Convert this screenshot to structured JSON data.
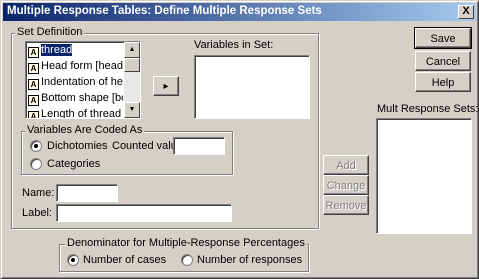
{
  "window": {
    "title": "Multiple Response Tables: Define Multiple Response Sets",
    "close_glyph": "X"
  },
  "set_definition": {
    "label": "Set Definition",
    "variables": [
      {
        "icon": "A",
        "name": "thread",
        "selected": true
      },
      {
        "icon": "A",
        "name": "Head form [head]"
      },
      {
        "icon": "A",
        "name": "Indentation of head"
      },
      {
        "icon": "A",
        "name": "Bottom shape [botto"
      },
      {
        "icon": "A",
        "name": "Length of thread [len"
      }
    ],
    "move_button": "▸",
    "variables_in_set_label": "Variables in Set:",
    "coded_as": {
      "label": "Variables Are Coded As",
      "dichotomies_label": "Dichotomies",
      "counted_value_label": "Counted value:",
      "counted_value": "",
      "categories_label": "Categories",
      "selected": "dichotomies"
    },
    "name_label": "Name:",
    "name_value": "",
    "label_label": "Label:",
    "label_value": ""
  },
  "set_buttons": {
    "add": "Add",
    "change": "Change",
    "remove": "Remove"
  },
  "dialog_buttons": {
    "save": "Save",
    "cancel": "Cancel",
    "help": "Help"
  },
  "mult_response_sets_label": "Mult Response Sets:",
  "denominator": {
    "label": "Denominator for Multiple-Response Percentages",
    "cases_label": "Number of cases",
    "responses_label": "Number of responses",
    "selected": "cases"
  }
}
